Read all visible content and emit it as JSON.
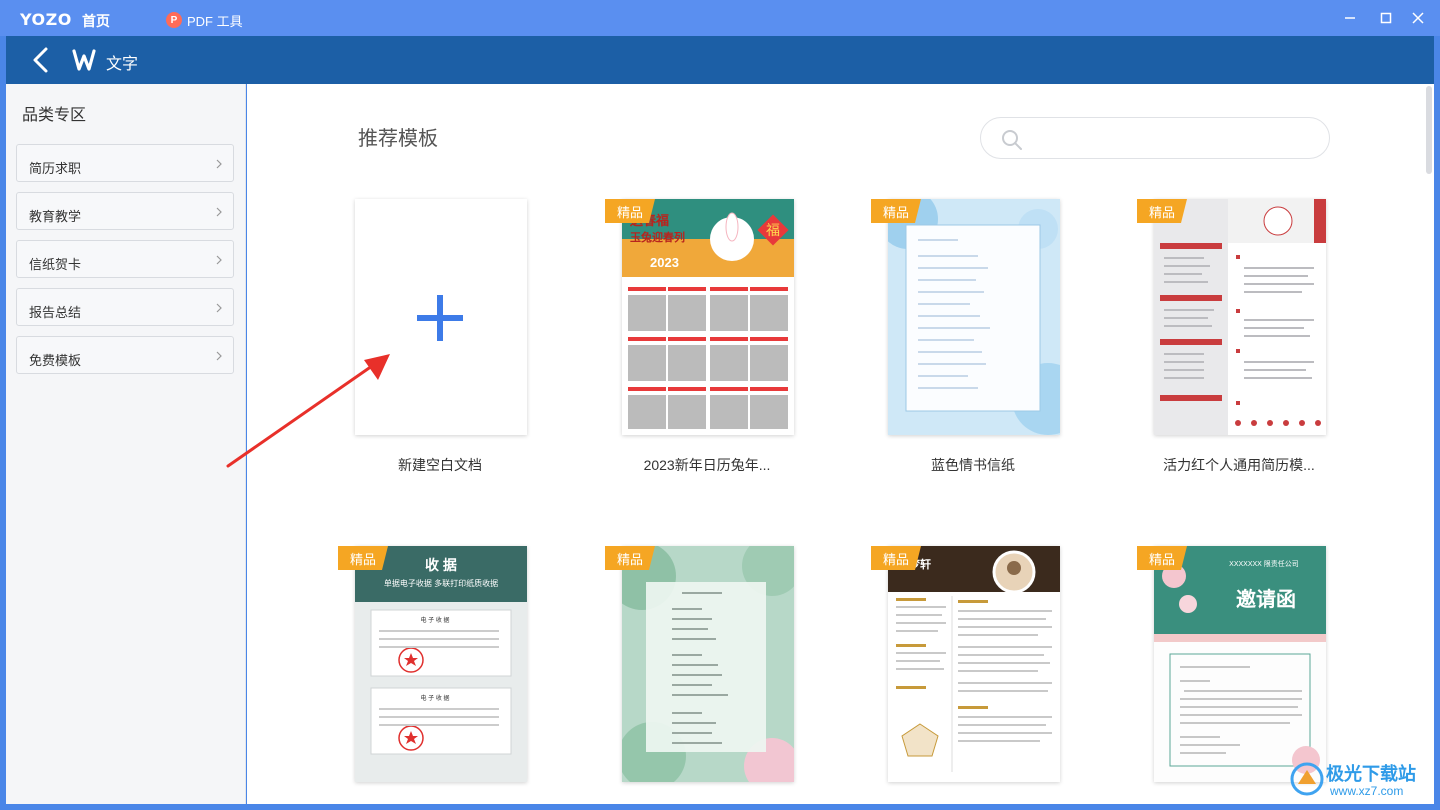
{
  "titlebar": {
    "brand": "YOZO",
    "home_tab": "首页",
    "pdf_icon": "P",
    "pdf_tab": "PDF 工具"
  },
  "navbar": {
    "title": "文字"
  },
  "sidebar": {
    "title": "品类专区",
    "items": [
      {
        "label": "简历求职"
      },
      {
        "label": "教育教学"
      },
      {
        "label": "信纸贺卡"
      },
      {
        "label": "报告总结"
      },
      {
        "label": "免费模板"
      }
    ]
  },
  "main": {
    "section_title": "推荐模板",
    "search_placeholder": "",
    "badge_label": "精品",
    "templates": [
      {
        "title": "新建空白文档",
        "premium": false
      },
      {
        "title": "2023新年日历兔年...",
        "premium": true
      },
      {
        "title": "蓝色情书信纸",
        "premium": true
      },
      {
        "title": "活力红个人通用简历模...",
        "premium": true
      },
      {
        "title": "",
        "premium": true
      },
      {
        "title": "",
        "premium": true
      },
      {
        "title": "",
        "premium": true
      },
      {
        "title": "",
        "premium": true
      }
    ],
    "thumb_text": {
      "calendar_banner_1": "送春福",
      "calendar_banner_2": "玉兔迎春列",
      "calendar_year": "2023",
      "calendar_fu": "福",
      "receipt_title": "收 据",
      "receipt_subtitle": "单据电子收据 多联打印纸质收据",
      "receipt_doc_1": "电 子 收 据",
      "receipt_doc_2": "电 子 收 据",
      "resume_name": "李梦轩",
      "invite_company": "XXXXXXX 限责任公司",
      "invite_title": "邀请函"
    }
  },
  "watermark": {
    "text": "极光下载站",
    "url": "www.xz7.com"
  }
}
